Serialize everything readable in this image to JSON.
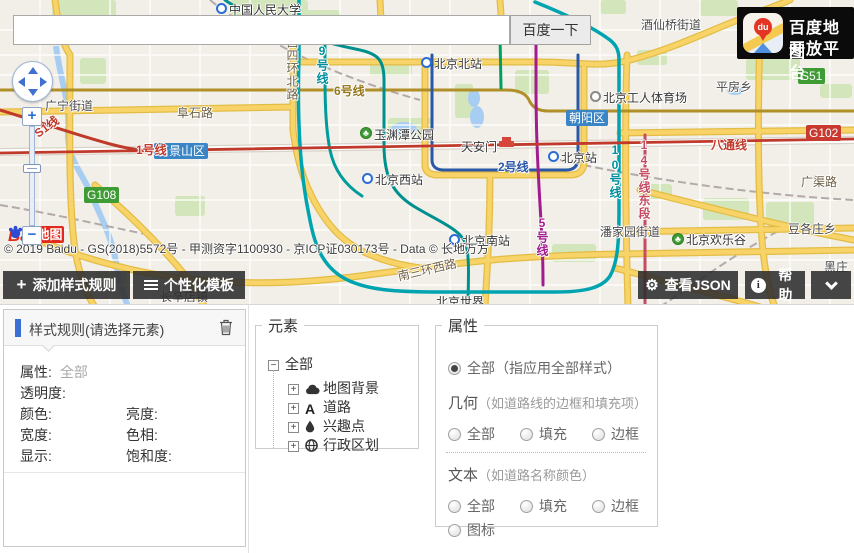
{
  "search": {
    "value": "",
    "button_label": "百度一下"
  },
  "platform_logo": {
    "line1": "百度地图",
    "line2": "开放平台",
    "pin_text": "du"
  },
  "map": {
    "attribution": "© 2019 Baidu - GS(2018)5572号 - 甲测资字1100930 - 京ICP证030173号 - Data © 长地万方",
    "corner_logo": {
      "bai": "Bai",
      "ditu": "地图"
    },
    "labels": [
      {
        "text": "中国人民大学"
      },
      {
        "text": "酒仙桥街道"
      },
      {
        "text": "北京北站"
      },
      {
        "text": "平房乡"
      },
      {
        "text": "S51"
      },
      {
        "text": "北京工人体育场"
      },
      {
        "text": "朝阳区"
      },
      {
        "text": "广宁街道"
      },
      {
        "text": "阜石路"
      },
      {
        "text": "6号线"
      },
      {
        "text": "西四环北路"
      },
      {
        "text": "9号线"
      },
      {
        "text": "石景山区"
      },
      {
        "text": "1号线"
      },
      {
        "text": "S1线"
      },
      {
        "text": "玉渊潭公园"
      },
      {
        "text": "天安门"
      },
      {
        "text": "2号线"
      },
      {
        "text": "北京站"
      },
      {
        "text": "G102"
      },
      {
        "text": "八通线"
      },
      {
        "text": "广渠路"
      },
      {
        "text": "北京西站"
      },
      {
        "text": "G108"
      },
      {
        "text": "潘家园街道"
      },
      {
        "text": "北京欢乐谷"
      },
      {
        "text": "豆各庄乡"
      },
      {
        "text": "北京南站"
      },
      {
        "text": "5号线"
      },
      {
        "text": "南三环西路"
      },
      {
        "text": "长辛店镇"
      },
      {
        "text": "10号线"
      },
      {
        "text": "14号线东段"
      },
      {
        "text": "黑庄"
      },
      {
        "text": "北京世界"
      }
    ]
  },
  "toolbar": {
    "add_rule": "添加样式规则",
    "custom_template": "个性化模板",
    "view_json": "查看JSON",
    "help": "帮助"
  },
  "rule_panel": {
    "title": "样式规则(请选择元素)",
    "attr_label": "属性:",
    "attr_value": "全部",
    "opacity_label": "透明度:",
    "color_label": "颜色:",
    "brightness_label": "亮度:",
    "width_label": "宽度:",
    "hue_label": "色相:",
    "display_label": "显示:",
    "saturation_label": "饱和度:"
  },
  "element_panel": {
    "legend": "元素",
    "root_label": "全部",
    "items": [
      {
        "label": "地图背景",
        "icon": "cloud-icon"
      },
      {
        "label": "道路",
        "icon": "road-icon"
      },
      {
        "label": "兴趣点",
        "icon": "poi-drop-icon"
      },
      {
        "label": "行政区划",
        "icon": "globe-icon"
      }
    ]
  },
  "attr_panel": {
    "legend": "属性",
    "all_label": "全部（指应用全部样式）",
    "geometry_title": "几何",
    "geometry_hint": "（如道路线的边框和填充项）",
    "geo_options": [
      "全部",
      "填充",
      "边框"
    ],
    "text_title": "文本",
    "text_hint": "（如道路名称颜色）",
    "text_options": [
      "全部",
      "填充",
      "边框",
      "图标"
    ]
  },
  "colors": {
    "accent_blue": "#3b6fd6",
    "toolbar_bg": "#3a3a3a",
    "badge_blue": "#3a85c6",
    "badge_green": "#3f9c35",
    "badge_red": "#c8392f",
    "line1_red": "#c03a2b",
    "line2_blue": "#2b57a7",
    "line5_magenta": "#a21c8e",
    "line6_olive": "#b08f28",
    "line10_teal": "#00a4b0",
    "road_yellow": "#f8d468"
  }
}
